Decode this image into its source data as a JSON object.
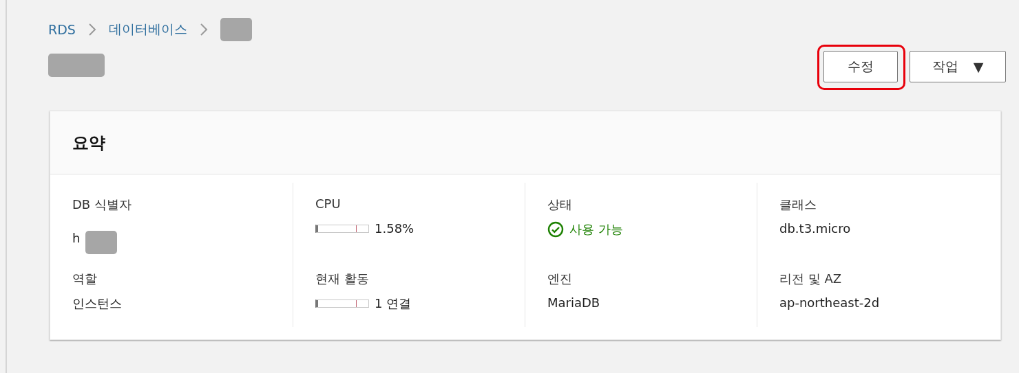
{
  "breadcrumbs": [
    {
      "label": "RDS",
      "kind": "link"
    },
    {
      "label": "데이터베이스",
      "kind": "link"
    },
    {
      "kind": "redacted"
    }
  ],
  "page_title": {
    "kind": "redacted"
  },
  "actions": [
    {
      "label": "수정",
      "kind": "plain",
      "highlighted": true
    },
    {
      "label": "작업",
      "kind": "dropdown",
      "caret": "▼"
    }
  ],
  "summary": {
    "title": "요약",
    "columns": [
      [
        {
          "label": "DB 식별자",
          "kind": "redacted_text",
          "value": "h"
        },
        {
          "label": "역할",
          "kind": "text",
          "value": "인스턴스"
        }
      ],
      [
        {
          "label": "CPU",
          "kind": "meter",
          "level": 0.02,
          "value": "1.58%"
        },
        {
          "label": "현재 활동",
          "kind": "meter",
          "level": 0.02,
          "value": "1 연결"
        }
      ],
      [
        {
          "label": "상태",
          "kind": "status",
          "value": "사용 가능"
        },
        {
          "label": "엔진",
          "kind": "text",
          "value": "MariaDB"
        }
      ],
      [
        {
          "label": "클래스",
          "kind": "text",
          "value": "db.t3.micro"
        },
        {
          "label": "리전 및 AZ",
          "kind": "text",
          "value": "ap-northeast-2d"
        }
      ]
    ]
  }
}
